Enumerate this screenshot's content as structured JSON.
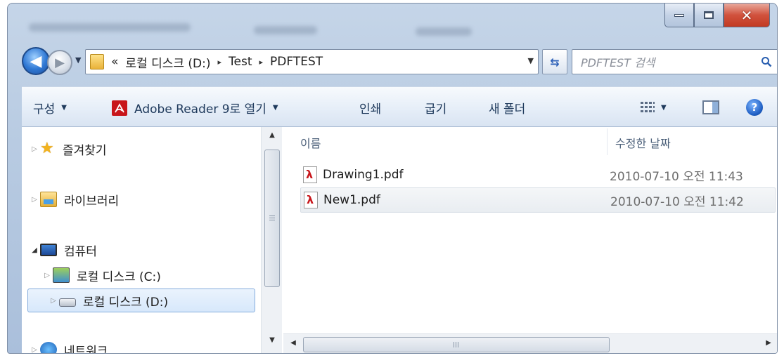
{
  "window": {
    "caption_buttons": [
      "minimize-icon",
      "maximize-icon",
      "close-icon"
    ]
  },
  "address_bar": {
    "history_symbol": "«",
    "breadcrumbs": [
      "로컬 디스크 (D:)",
      "Test",
      "PDFTEST"
    ],
    "separator_symbol": "▸"
  },
  "search": {
    "placeholder": "PDFTEST 검색"
  },
  "toolbar": {
    "organize": "구성",
    "open_with": "Adobe Reader 9로 열기",
    "print": "인쇄",
    "burn": "굽기",
    "new_folder": "새 폴더"
  },
  "nav_pane": {
    "items": [
      {
        "label": "즐겨찾기",
        "icon": "star-icon"
      },
      {
        "label": "라이브러리",
        "icon": "library-icon"
      },
      {
        "label": "컴퓨터",
        "icon": "computer-icon"
      },
      {
        "label": "로컬 디스크 (C:)",
        "icon": "drive-icon"
      },
      {
        "label": "로컬 디스크 (D:)",
        "icon": "drive-icon"
      },
      {
        "label": "네트워크",
        "icon": "network-icon"
      }
    ]
  },
  "file_list": {
    "columns": {
      "name": "이름",
      "modified": "수정한 날짜"
    },
    "rows": [
      {
        "name": "Drawing1.pdf",
        "modified": "2010-07-10 오전 11:43"
      },
      {
        "name": "New1.pdf",
        "modified": "2010-07-10 오전 11:42"
      }
    ]
  },
  "scrollbar": {
    "grip_symbol": "III"
  }
}
